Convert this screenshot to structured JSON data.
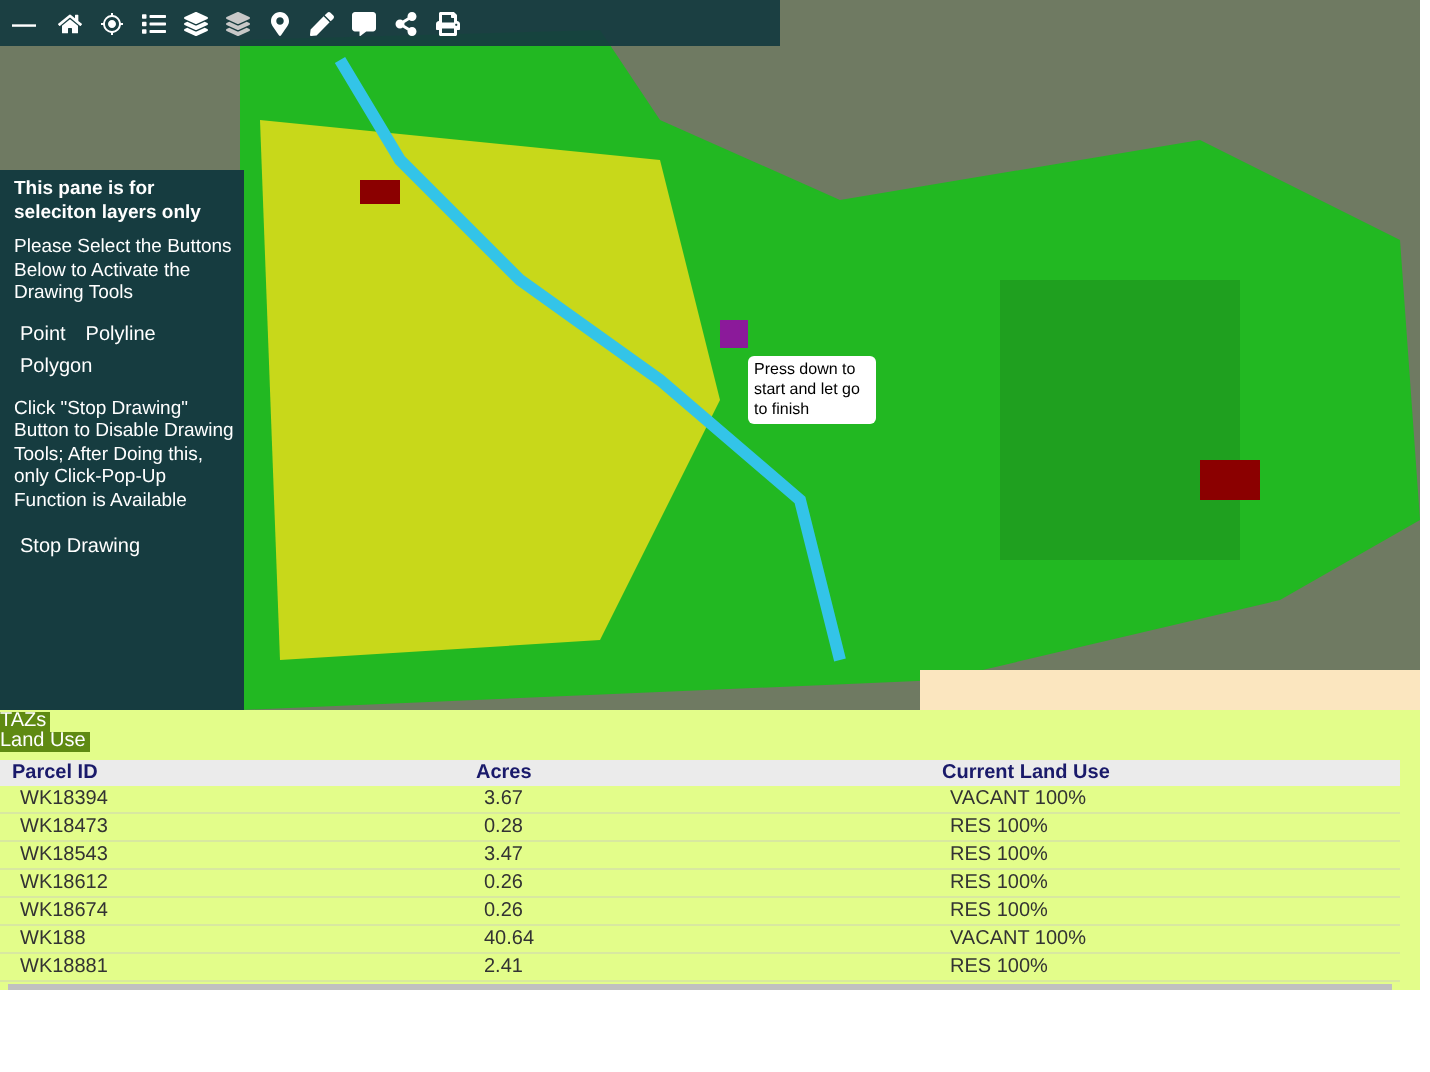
{
  "toolbar": {
    "collapse": "—"
  },
  "pane": {
    "title": "This pane is for seleciton layers only",
    "instructions": "Please Select the Buttons Below to Activate the Drawing Tools",
    "buttons": [
      "Point",
      "Polyline",
      "Polygon"
    ],
    "note": "Click \"Stop Drawing\" Button to Disable Drawing Tools; After Doing this, only Click-Pop-Up Function is Available",
    "stop": "Stop Drawing"
  },
  "tooltip": "Press down to start and let go to finish",
  "panel": {
    "layers": [
      "TAZs",
      "Land Use"
    ],
    "columns": [
      "Parcel ID",
      "Acres",
      "Current Land Use"
    ],
    "rows": [
      [
        "WK18394",
        "3.67",
        "VACANT 100%"
      ],
      [
        "WK18473",
        "0.28",
        "RES 100%"
      ],
      [
        "WK18543",
        "3.47",
        "RES 100%"
      ],
      [
        "WK18612",
        "0.26",
        "RES 100%"
      ],
      [
        "WK18674",
        "0.26",
        "RES 100%"
      ],
      [
        "WK188",
        "40.64",
        "VACANT 100%"
      ],
      [
        "WK18881",
        "2.41",
        "RES 100%"
      ]
    ]
  }
}
